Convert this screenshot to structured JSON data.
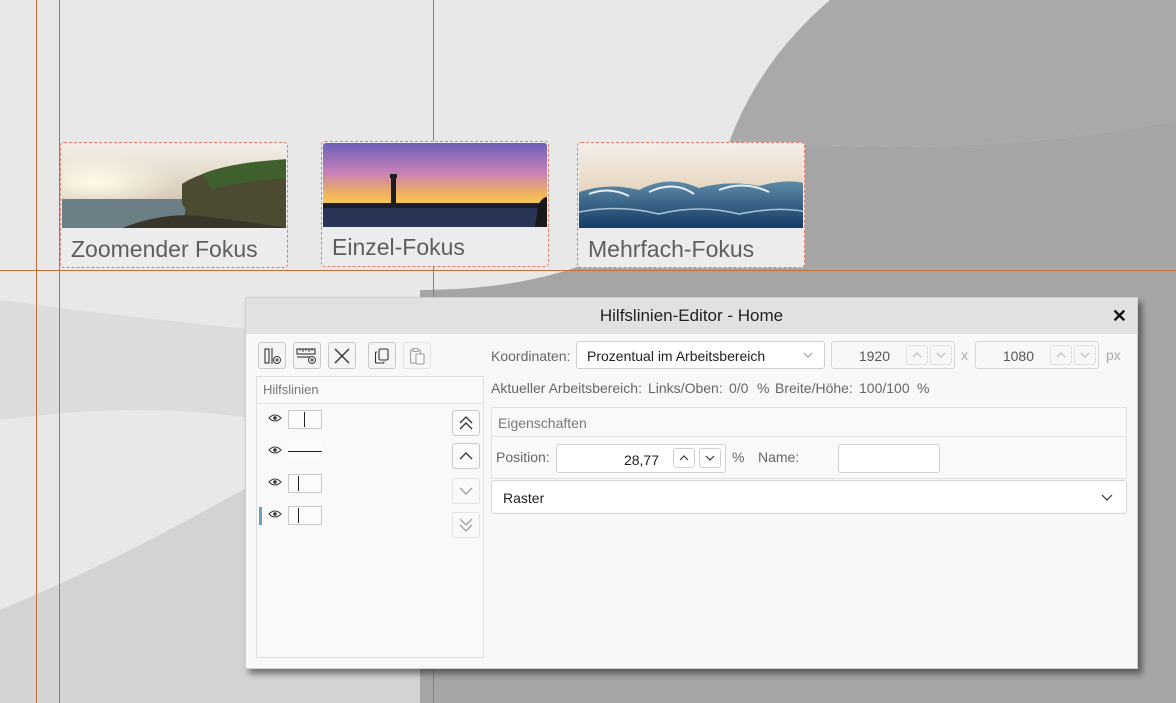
{
  "tiles": [
    {
      "label": "Zoomender Fokus",
      "image": "coast-sunset-photo"
    },
    {
      "label": "Einzel-Fokus",
      "image": "lighthouse-sunset-photo"
    },
    {
      "label": "Mehrfach-Fokus",
      "image": "ocean-waves-photo"
    }
  ],
  "dialog": {
    "title": "Hilfslinien-Editor - Home",
    "close_label": "✕",
    "toolbar": {
      "icons": [
        "add-vertical-guide-icon",
        "add-horizontal-guide-icon",
        "delete-icon",
        "copy-icon",
        "paste-icon"
      ]
    },
    "list": {
      "header": "Hilfslinien",
      "items": [
        {
          "orientation": "vertical",
          "visible": true,
          "selected": false
        },
        {
          "orientation": "horizontal",
          "visible": true,
          "selected": false
        },
        {
          "orientation": "vertical",
          "visible": true,
          "selected": false
        },
        {
          "orientation": "vertical",
          "visible": true,
          "selected": true
        }
      ]
    },
    "coordinates": {
      "label": "Koordinaten:",
      "mode": "Prozentual im Arbeitsbereich",
      "width": "1920",
      "separator": "x",
      "height": "1080",
      "unit": "px"
    },
    "workarea": {
      "label": "Aktueller Arbeitsbereich:",
      "left_top_label": "Links/Oben:",
      "left_top_value": "0/0",
      "left_top_unit": "%",
      "size_label": "Breite/Höhe:",
      "size_value": "100/100",
      "size_unit": "%"
    },
    "properties": {
      "header": "Eigenschaften",
      "position_label": "Position:",
      "position_value": "28,77",
      "position_unit": "%",
      "name_label": "Name:",
      "name_value": ""
    },
    "raster": {
      "label": "Raster"
    }
  },
  "colors": {
    "guide": "#c0703f",
    "tile_border": "#e07a6a",
    "selection": "#6aa0c0"
  }
}
